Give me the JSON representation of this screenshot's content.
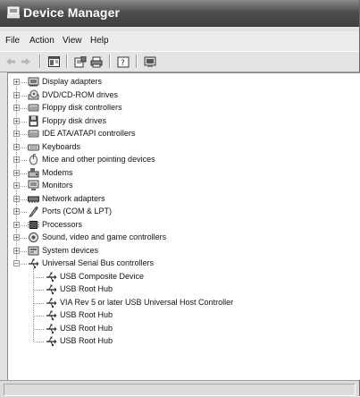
{
  "window": {
    "title": "Device Manager"
  },
  "menu": {
    "items": [
      "File",
      "Action",
      "View",
      "Help"
    ]
  },
  "tree": {
    "categories": [
      {
        "label": "Display adapters",
        "icon": "display-adapter-icon"
      },
      {
        "label": "DVD/CD-ROM drives",
        "icon": "dvd-drive-icon"
      },
      {
        "label": "Floppy disk controllers",
        "icon": "disk-controller-icon"
      },
      {
        "label": "Floppy disk drives",
        "icon": "floppy-drive-icon"
      },
      {
        "label": "IDE ATA/ATAPI controllers",
        "icon": "disk-controller-icon"
      },
      {
        "label": "Keyboards",
        "icon": "keyboard-icon"
      },
      {
        "label": "Mice and other pointing devices",
        "icon": "mouse-icon"
      },
      {
        "label": "Modems",
        "icon": "modem-icon"
      },
      {
        "label": "Monitors",
        "icon": "monitor-icon"
      },
      {
        "label": "Network adapters",
        "icon": "network-adapter-icon"
      },
      {
        "label": "Ports (COM & LPT)",
        "icon": "port-icon"
      },
      {
        "label": "Processors",
        "icon": "processor-icon"
      },
      {
        "label": "Sound, video and game controllers",
        "icon": "sound-icon"
      },
      {
        "label": "System devices",
        "icon": "system-device-icon"
      },
      {
        "label": "Universal Serial Bus controllers",
        "icon": "usb-icon",
        "expanded": true
      }
    ],
    "usb_children": [
      "USB Composite Device",
      "USB Root Hub",
      "VIA Rev 5 or later USB Universal Host Controller",
      "USB Root Hub",
      "USB Root Hub",
      "USB Root Hub"
    ]
  }
}
